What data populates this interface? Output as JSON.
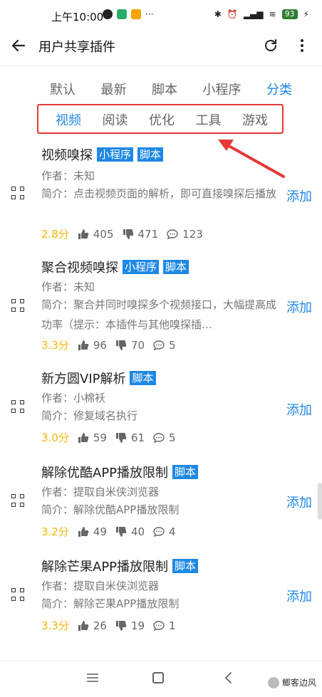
{
  "status": {
    "time": "上午10:00",
    "battery": "93"
  },
  "header": {
    "title": "用户共享插件"
  },
  "sort_tabs": [
    {
      "label": "默认"
    },
    {
      "label": "最新"
    },
    {
      "label": "脚本"
    },
    {
      "label": "小程序"
    },
    {
      "label": "分类",
      "active": true
    }
  ],
  "subcategories": [
    {
      "label": "视频",
      "active": true
    },
    {
      "label": "阅读"
    },
    {
      "label": "优化"
    },
    {
      "label": "工具"
    },
    {
      "label": "游戏"
    }
  ],
  "plugins": [
    {
      "title": "视频嗅探",
      "tags": [
        "小程序",
        "脚本"
      ],
      "author": "作者：未知",
      "desc": "简介：点击视频页面的解析，即可直接嗅探后播放",
      "score": "2.8分",
      "likes": "405",
      "dislikes": "471",
      "comments": "123",
      "add_label": "添加"
    },
    {
      "title": "聚合视频嗅探",
      "tags": [
        "小程序",
        "脚本"
      ],
      "author": "作者：未知",
      "desc": "简介：聚合并同时嗅探多个视频接口，大幅提高成功率（提示：本插件与其他嗅探插…",
      "score": "3.3分",
      "likes": "96",
      "dislikes": "70",
      "comments": "5",
      "add_label": "添加"
    },
    {
      "title": "新方圆VIP解析",
      "tags": [
        "脚本"
      ],
      "author": "作者：小棉袄",
      "desc": "简介：修复域名执行",
      "score": "3.0分",
      "likes": "59",
      "dislikes": "61",
      "comments": "5",
      "add_label": "添加"
    },
    {
      "title": "解除优酷APP播放限制",
      "tags": [
        "脚本"
      ],
      "author": "作者：提取自米侠浏览器",
      "desc": "简介：解除优酷APP播放限制",
      "score": "3.2分",
      "likes": "49",
      "dislikes": "40",
      "comments": "4",
      "add_label": "添加"
    },
    {
      "title": "解除芒果APP播放限制",
      "tags": [
        "脚本"
      ],
      "author": "作者：提取自米侠浏览器",
      "desc": "简介：解除芒果APP播放限制",
      "score": "3.3分",
      "likes": "26",
      "dislikes": "19",
      "comments": "1",
      "add_label": "添加"
    }
  ],
  "watermark": {
    "text": "鲫客边风"
  },
  "colors": {
    "accent": "#1e88e5",
    "score": "#f2b705",
    "highlight_border": "#e53935"
  }
}
